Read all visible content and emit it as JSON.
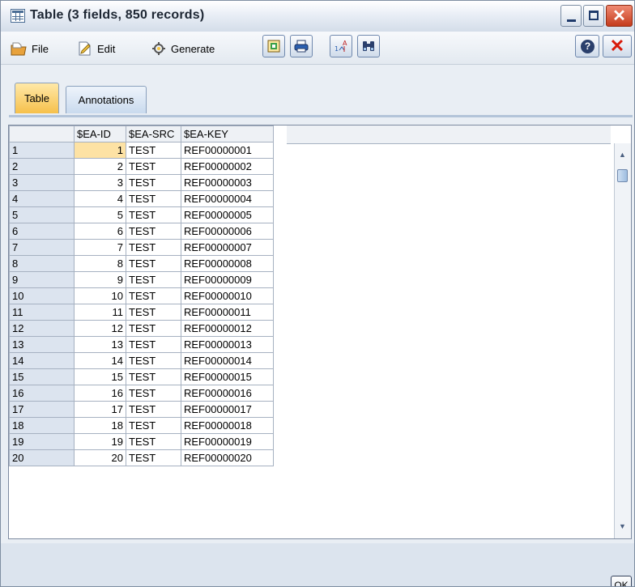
{
  "window": {
    "title": "Table (3 fields, 850 records)"
  },
  "menu": {
    "file": "File",
    "edit": "Edit",
    "generate": "Generate"
  },
  "tabs": [
    {
      "label": "Table"
    },
    {
      "label": "Annotations"
    }
  ],
  "table": {
    "columns": [
      "$EA-ID",
      "$EA-SRC",
      "$EA-KEY"
    ],
    "rows": [
      [
        "1",
        "1",
        "TEST",
        "REF00000001"
      ],
      [
        "2",
        "2",
        "TEST",
        "REF00000002"
      ],
      [
        "3",
        "3",
        "TEST",
        "REF00000003"
      ],
      [
        "4",
        "4",
        "TEST",
        "REF00000004"
      ],
      [
        "5",
        "5",
        "TEST",
        "REF00000005"
      ],
      [
        "6",
        "6",
        "TEST",
        "REF00000006"
      ],
      [
        "7",
        "7",
        "TEST",
        "REF00000007"
      ],
      [
        "8",
        "8",
        "TEST",
        "REF00000008"
      ],
      [
        "9",
        "9",
        "TEST",
        "REF00000009"
      ],
      [
        "10",
        "10",
        "TEST",
        "REF00000010"
      ],
      [
        "11",
        "11",
        "TEST",
        "REF00000011"
      ],
      [
        "12",
        "12",
        "TEST",
        "REF00000012"
      ],
      [
        "13",
        "13",
        "TEST",
        "REF00000013"
      ],
      [
        "14",
        "14",
        "TEST",
        "REF00000014"
      ],
      [
        "15",
        "15",
        "TEST",
        "REF00000015"
      ],
      [
        "16",
        "16",
        "TEST",
        "REF00000016"
      ],
      [
        "17",
        "17",
        "TEST",
        "REF00000017"
      ],
      [
        "18",
        "18",
        "TEST",
        "REF00000018"
      ],
      [
        "19",
        "19",
        "TEST",
        "REF00000019"
      ],
      [
        "20",
        "20",
        "TEST",
        "REF00000020"
      ]
    ]
  },
  "buttons": {
    "ok": "OK",
    "help": "?",
    "close": "✕"
  },
  "colors": {
    "active_tab": "#f6c04b",
    "selected_cell": "#fde2a4",
    "close_red": "#d81a0a"
  }
}
